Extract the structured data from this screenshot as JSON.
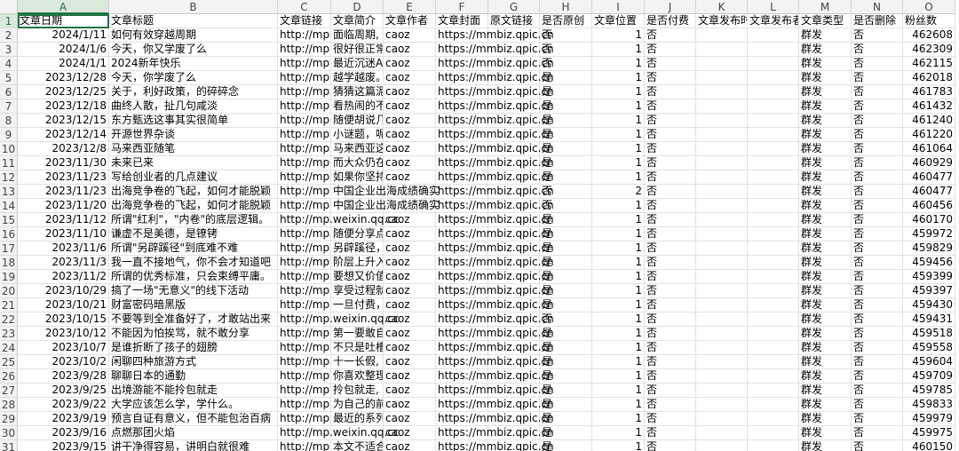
{
  "columns": [
    "A",
    "B",
    "C",
    "D",
    "E",
    "F",
    "G",
    "H",
    "I",
    "J",
    "K",
    "L",
    "M",
    "N",
    "O"
  ],
  "header_row": [
    "文章日期",
    "文章标题",
    "文章链接",
    "文章简介",
    "文章作者",
    "文章封面",
    "原文链接",
    "是否原创",
    "文章位置",
    "是否付费",
    "文章发布时",
    "文章发布者",
    "文章类型",
    "是否删除",
    "粉丝数"
  ],
  "rows": [
    [
      "2024/1/11",
      "如何有效穿越周期",
      "http://mp.",
      "面临周期,",
      "caoz",
      "https://mmbiz.qpic.cn",
      "否",
      "1",
      "否",
      "",
      "",
      "群发",
      "否",
      "462608"
    ],
    [
      "2024/1/6",
      "今天，你又学废了么",
      "http://mp.",
      "很好很正常",
      "caoz",
      "https://mmbiz.qpic.cn",
      "否",
      "1",
      "否",
      "",
      "",
      "群发",
      "否",
      "462309"
    ],
    [
      "2024/1/1",
      "2024新年快乐",
      "http://mp.",
      "最近沉迷A",
      "caoz",
      "https://mmbiz.qpic.cn",
      "否",
      "1",
      "否",
      "",
      "",
      "群发",
      "否",
      "462115"
    ],
    [
      "2023/12/28",
      "今天，你学废了么",
      "http://mp.",
      "越学越废。",
      "caoz",
      "https://mmbiz.qpic.cn",
      "是",
      "1",
      "否",
      "",
      "",
      "群发",
      "否",
      "462018"
    ],
    [
      "2023/12/25",
      "关于，利好政策，的碎碎念",
      "http://mp.",
      "猜猜这篇泥",
      "caoz",
      "https://mmbiz.qpic.cn",
      "是",
      "1",
      "否",
      "",
      "",
      "群发",
      "否",
      "461783"
    ],
    [
      "2023/12/18",
      "曲终人散，扯几句咸淡",
      "http://mp.",
      "看热闹的不",
      "caoz",
      "https://mmbiz.qpic.cn",
      "是",
      "1",
      "否",
      "",
      "",
      "群发",
      "否",
      "461432"
    ],
    [
      "2023/12/15",
      "东方甄选这事其实很简单",
      "http://mp.",
      "随便胡说几句。",
      "caoz",
      "https://mmbiz.qpic.cn",
      "是",
      "1",
      "否",
      "",
      "",
      "群发",
      "否",
      "461240"
    ],
    [
      "2023/12/14",
      "开源世界杂谈",
      "http://mp.",
      "小谜题，呢",
      "caoz",
      "https://mmbiz.qpic.cn",
      "是",
      "1",
      "否",
      "",
      "",
      "群发",
      "否",
      "461220"
    ],
    [
      "2023/12/8",
      "马来西亚随笔",
      "http://mp.",
      "马来西亚这",
      "caoz",
      "https://mmbiz.qpic.cn",
      "是",
      "1",
      "否",
      "",
      "",
      "群发",
      "否",
      "461064"
    ],
    [
      "2023/11/30",
      "未来已来",
      "http://mp.",
      "而大众仍在",
      "caoz",
      "https://mmbiz.qpic.cn",
      "是",
      "1",
      "否",
      "",
      "",
      "群发",
      "否",
      "460929"
    ],
    [
      "2023/11/23",
      "写给创业者的几点建议",
      "http://mp.",
      "如果你坚持",
      "caoz",
      "https://mmbiz.qpic.cn",
      "是",
      "1",
      "否",
      "",
      "",
      "群发",
      "否",
      "460477"
    ],
    [
      "2023/11/23",
      "出海竞争卷的飞起，如何才能脱颖",
      "http://mp.",
      "中国企业出海成绩确实",
      "",
      "https://mmbiz.qpic.cn",
      "否",
      "2",
      "否",
      "",
      "",
      "群发",
      "否",
      "460477"
    ],
    [
      "2023/11/20",
      "出海竞争卷的飞起，如何才能脱颖",
      "http://mp.",
      "中国企业出海成绩确实",
      "",
      "https://mmbiz.qpic.cn",
      "否",
      "1",
      "否",
      "",
      "",
      "群发",
      "否",
      "460456"
    ],
    [
      "2023/11/12",
      "所谓\"红利\"，\"内卷\"的底层逻辑。",
      "http://mp.weixin.qq.cc",
      "",
      "caoz",
      "https://mmbiz.qpic.cn",
      "是",
      "1",
      "否",
      "",
      "",
      "群发",
      "否",
      "460170"
    ],
    [
      "2023/11/10",
      "谦虚不是美德，是镣铐",
      "http://mp.",
      "随便分享点",
      "caoz",
      "https://mmbiz.qpic.cn",
      "是",
      "1",
      "否",
      "",
      "",
      "群发",
      "否",
      "459972"
    ],
    [
      "2023/11/6",
      "所谓\"另辟蹊径\"到底难不难",
      "http://mp.",
      "另辟蹊径，",
      "caoz",
      "https://mmbiz.qpic.cn",
      "是",
      "1",
      "否",
      "",
      "",
      "群发",
      "否",
      "459829"
    ],
    [
      "2023/11/3",
      "我一直不接地气，你不会才知道吧",
      "http://mp.",
      "阶层上升入",
      "caoz",
      "https://mmbiz.qpic.cn",
      "是",
      "1",
      "否",
      "",
      "",
      "群发",
      "否",
      "459456"
    ],
    [
      "2023/11/2",
      "所谓的优秀标准，只会束缚平庸。",
      "http://mp.",
      "要想又价值",
      "caoz",
      "https://mmbiz.qpic.cn",
      "是",
      "1",
      "否",
      "",
      "",
      "群发",
      "否",
      "459399"
    ],
    [
      "2023/10/29",
      "搞了一场\"无意义\"的线下活动",
      "http://mp.",
      "享受过程就",
      "caoz",
      "https://mmbiz.qpic.cn",
      "是",
      "1",
      "否",
      "",
      "",
      "群发",
      "否",
      "459397"
    ],
    [
      "2023/10/21",
      "财富密码暗黑版",
      "http://mp.",
      "一旦付费，",
      "caoz",
      "https://mmbiz.qpic.cn",
      "是",
      "1",
      "否",
      "",
      "",
      "群发",
      "否",
      "459430"
    ],
    [
      "2023/10/15",
      "不要等到全准备好了，才敢站出来",
      "http://mp.weixin.qq.cc",
      "",
      "caoz",
      "https://mmbiz.qpic.cn",
      "否",
      "1",
      "否",
      "",
      "",
      "群发",
      "否",
      "459431"
    ],
    [
      "2023/10/12",
      "不能因为怕挨骂，就不敢分享",
      "http://mp.",
      "第一要敢自",
      "caoz",
      "https://mmbiz.qpic.cn",
      "是",
      "1",
      "否",
      "",
      "",
      "群发",
      "否",
      "459518"
    ],
    [
      "2023/10/7",
      "是谁折断了孩子的翅膀",
      "http://mp.",
      "不只是吐槽",
      "caoz",
      "https://mmbiz.qpic.cn",
      "是",
      "1",
      "否",
      "",
      "",
      "群发",
      "否",
      "459558"
    ],
    [
      "2023/10/2",
      "闲聊四种旅游方式",
      "http://mp.",
      "十一长假,",
      "caoz",
      "https://mmbiz.qpic.cn",
      "是",
      "1",
      "否",
      "",
      "",
      "群发",
      "否",
      "459604"
    ],
    [
      "2023/9/28",
      "聊聊日本的通勤",
      "http://mp.",
      "你喜欢整理",
      "caoz",
      "https://mmbiz.qpic.cn",
      "是",
      "1",
      "否",
      "",
      "",
      "群发",
      "否",
      "459709"
    ],
    [
      "2023/9/25",
      "出境游能不能拎包就走",
      "http://mp.",
      "拎包就走,",
      "caoz",
      "https://mmbiz.qpic.cn",
      "是",
      "1",
      "否",
      "",
      "",
      "群发",
      "否",
      "459785"
    ],
    [
      "2023/9/22",
      "大学应该怎么学，学什么。",
      "http://mp.",
      "为自己的前",
      "caoz",
      "https://mmbiz.qpic.cn",
      "是",
      "1",
      "否",
      "",
      "",
      "群发",
      "否",
      "459833"
    ],
    [
      "2023/9/19",
      "预言自证有意义，但不能包治百病",
      "http://mp.",
      "最近的系列",
      "caoz",
      "https://mmbiz.qpic.cn",
      "是",
      "1",
      "否",
      "",
      "",
      "群发",
      "否",
      "459979"
    ],
    [
      "2023/9/16",
      "点燃那团火焰",
      "http://mp.weixin.qq.cc",
      "",
      "caoz",
      "https://mmbiz.qpic.cn",
      "是",
      "1",
      "否",
      "",
      "",
      "群发",
      "否",
      "459975"
    ],
    [
      "2023/9/15",
      "讲干净得容易，讲明白就很难",
      "http://mp.",
      "本文不适合",
      "caoz",
      "https://mmbiz.qpic.cn",
      "是",
      "1",
      "否",
      "",
      "",
      "群发",
      "否",
      "460150"
    ]
  ]
}
